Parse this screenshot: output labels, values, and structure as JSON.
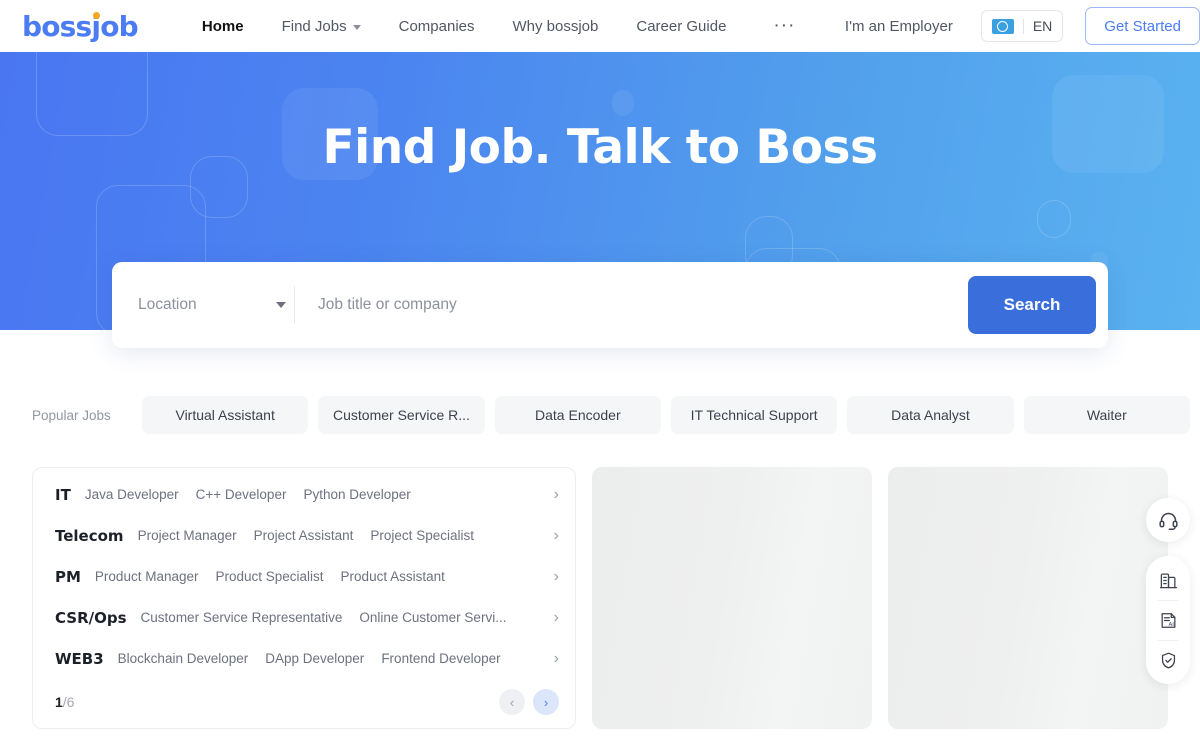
{
  "header": {
    "logo_text": "bossjob",
    "nav": [
      {
        "label": "Home",
        "active": true,
        "has_caret": false
      },
      {
        "label": "Find Jobs",
        "active": false,
        "has_caret": true
      },
      {
        "label": "Companies",
        "active": false,
        "has_caret": false
      },
      {
        "label": "Why bossjob",
        "active": false,
        "has_caret": false
      },
      {
        "label": "Career Guide",
        "active": false,
        "has_caret": false
      }
    ],
    "more_label": "···",
    "employer_label": "I'm an Employer",
    "language_code": "EN",
    "get_started_label": "Get Started"
  },
  "hero": {
    "title": "Find Job. Talk to Boss",
    "gradient_from": "#4a76f2",
    "gradient_to": "#5ab2f0"
  },
  "search": {
    "location_label": "Location",
    "job_placeholder": "Job title or company",
    "job_value": "",
    "search_button": "Search",
    "button_color": "#3a6fdb"
  },
  "popular": {
    "label": "Popular Jobs",
    "chips": [
      "Virtual Assistant",
      "Customer Service R...",
      "Data Encoder",
      "IT Technical Support",
      "Data Analyst",
      "Waiter"
    ]
  },
  "categories": {
    "rows": [
      {
        "name": "IT",
        "tags": [
          "Java Developer",
          "C++ Developer",
          "Python Developer"
        ]
      },
      {
        "name": "Telecom",
        "tags": [
          "Project Manager",
          "Project Assistant",
          "Project Specialist"
        ]
      },
      {
        "name": "PM",
        "tags": [
          "Product Manager",
          "Product Specialist",
          "Product Assistant"
        ]
      },
      {
        "name": "CSR/Ops",
        "tags": [
          "Customer Service Representative",
          "Online Customer Servi..."
        ]
      },
      {
        "name": "WEB3",
        "tags": [
          "Blockchain Developer",
          "DApp Developer",
          "Frontend Developer"
        ]
      }
    ],
    "page_current": "1",
    "page_total": "/6"
  },
  "dock": {
    "items": [
      {
        "icon": "headset-icon"
      },
      {
        "icon": "building-icon"
      },
      {
        "icon": "ai-resume-icon"
      },
      {
        "icon": "shield-check-icon"
      }
    ]
  }
}
